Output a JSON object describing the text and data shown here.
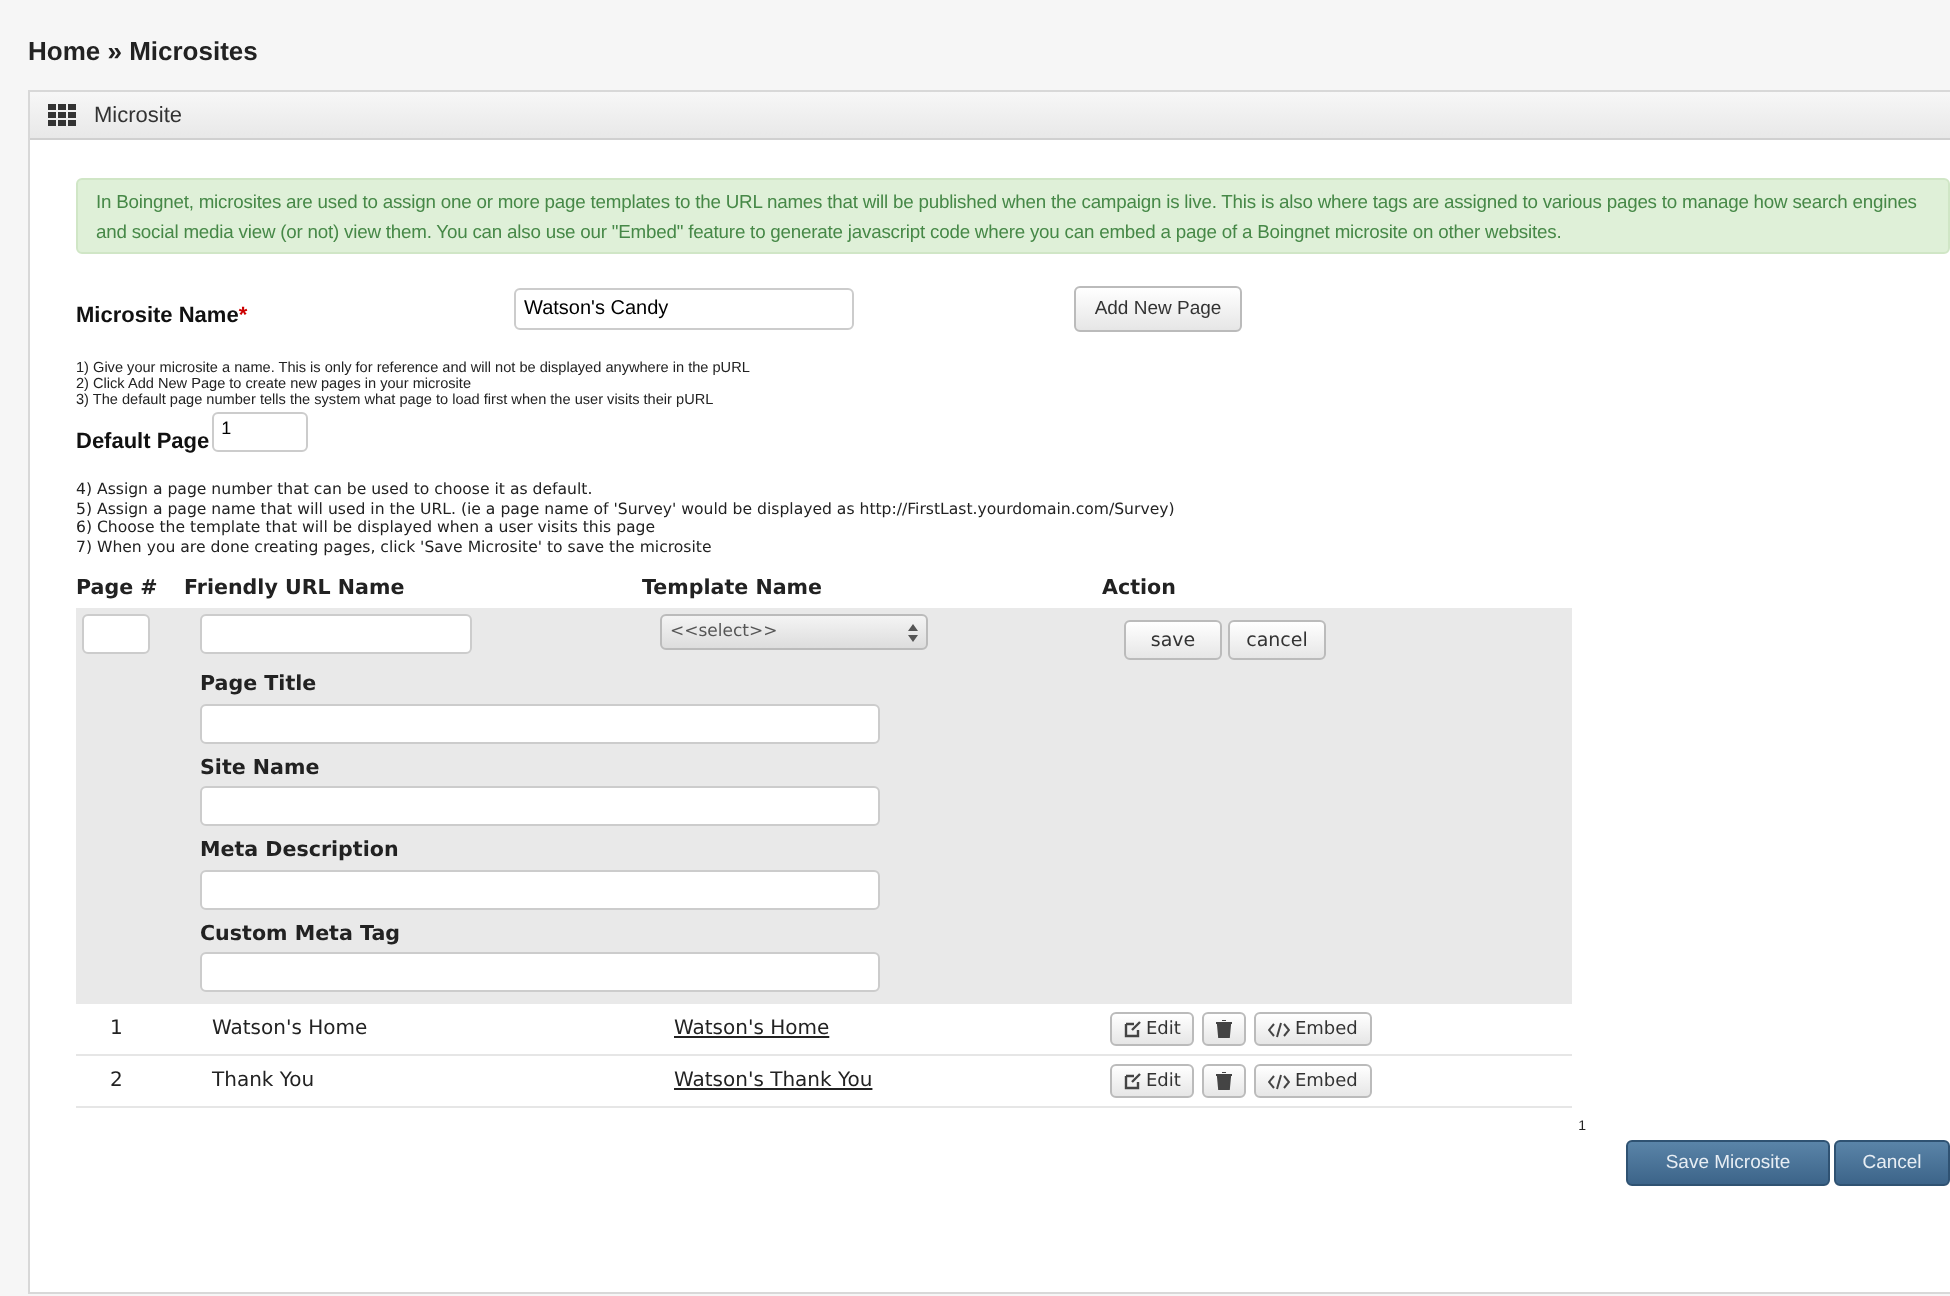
{
  "breadcrumb": "Home » Microsites",
  "panel": {
    "title": "Microsite"
  },
  "info": "In Boingnet, microsites are used to assign one or more page templates to the URL names that will be published when the campaign is live. This is also where tags are assigned to various pages to manage how search engines and social media view (or not) view them. You can also use our \"Embed\" feature to generate javascript code where you can embed a page of a Boingnet microsite on other websites.",
  "microsite_name": {
    "label": "Microsite Name",
    "required_mark": "*",
    "value": "Watson's Candy"
  },
  "add_page_button": "Add New Page",
  "instructions_1": [
    "1) Give your microsite a name. This is only for reference and will not be displayed anywhere in the pURL",
    "2) Click Add New Page to create new pages in your microsite",
    "3) The default page number tells the system what page to load first when the user visits their pURL"
  ],
  "default_page": {
    "label": "Default Page",
    "value": "1"
  },
  "instructions_2": [
    "4) Assign a page number that can be used to choose it as default.",
    "5) Assign a page name that will used in the URL. (ie a page name of 'Survey' would be displayed as http://FirstLast.yourdomain.com/Survey)",
    "6) Choose the template that will be displayed when a user visits this page",
    "7) When you are done creating pages, click 'Save Microsite' to save the microsite"
  ],
  "table": {
    "columns": [
      "Page #",
      "Friendly URL Name",
      "Template Name",
      "Action"
    ],
    "new_row": {
      "select": "<<select>>",
      "save": "save",
      "cancel": "cancel",
      "fields": [
        "Page Title",
        "Site Name",
        "Meta Description",
        "Custom Meta Tag"
      ]
    },
    "rows": [
      {
        "page": "1",
        "name": "Watson's Home",
        "template": "Watson's Home",
        "edit": "Edit",
        "embed": "Embed"
      },
      {
        "page": "2",
        "name": "Thank You",
        "template": "Watson's Thank You",
        "edit": "Edit",
        "embed": "Embed"
      }
    ]
  },
  "pagination": "1",
  "buttons": {
    "save": "Save Microsite",
    "cancel": "Cancel"
  }
}
